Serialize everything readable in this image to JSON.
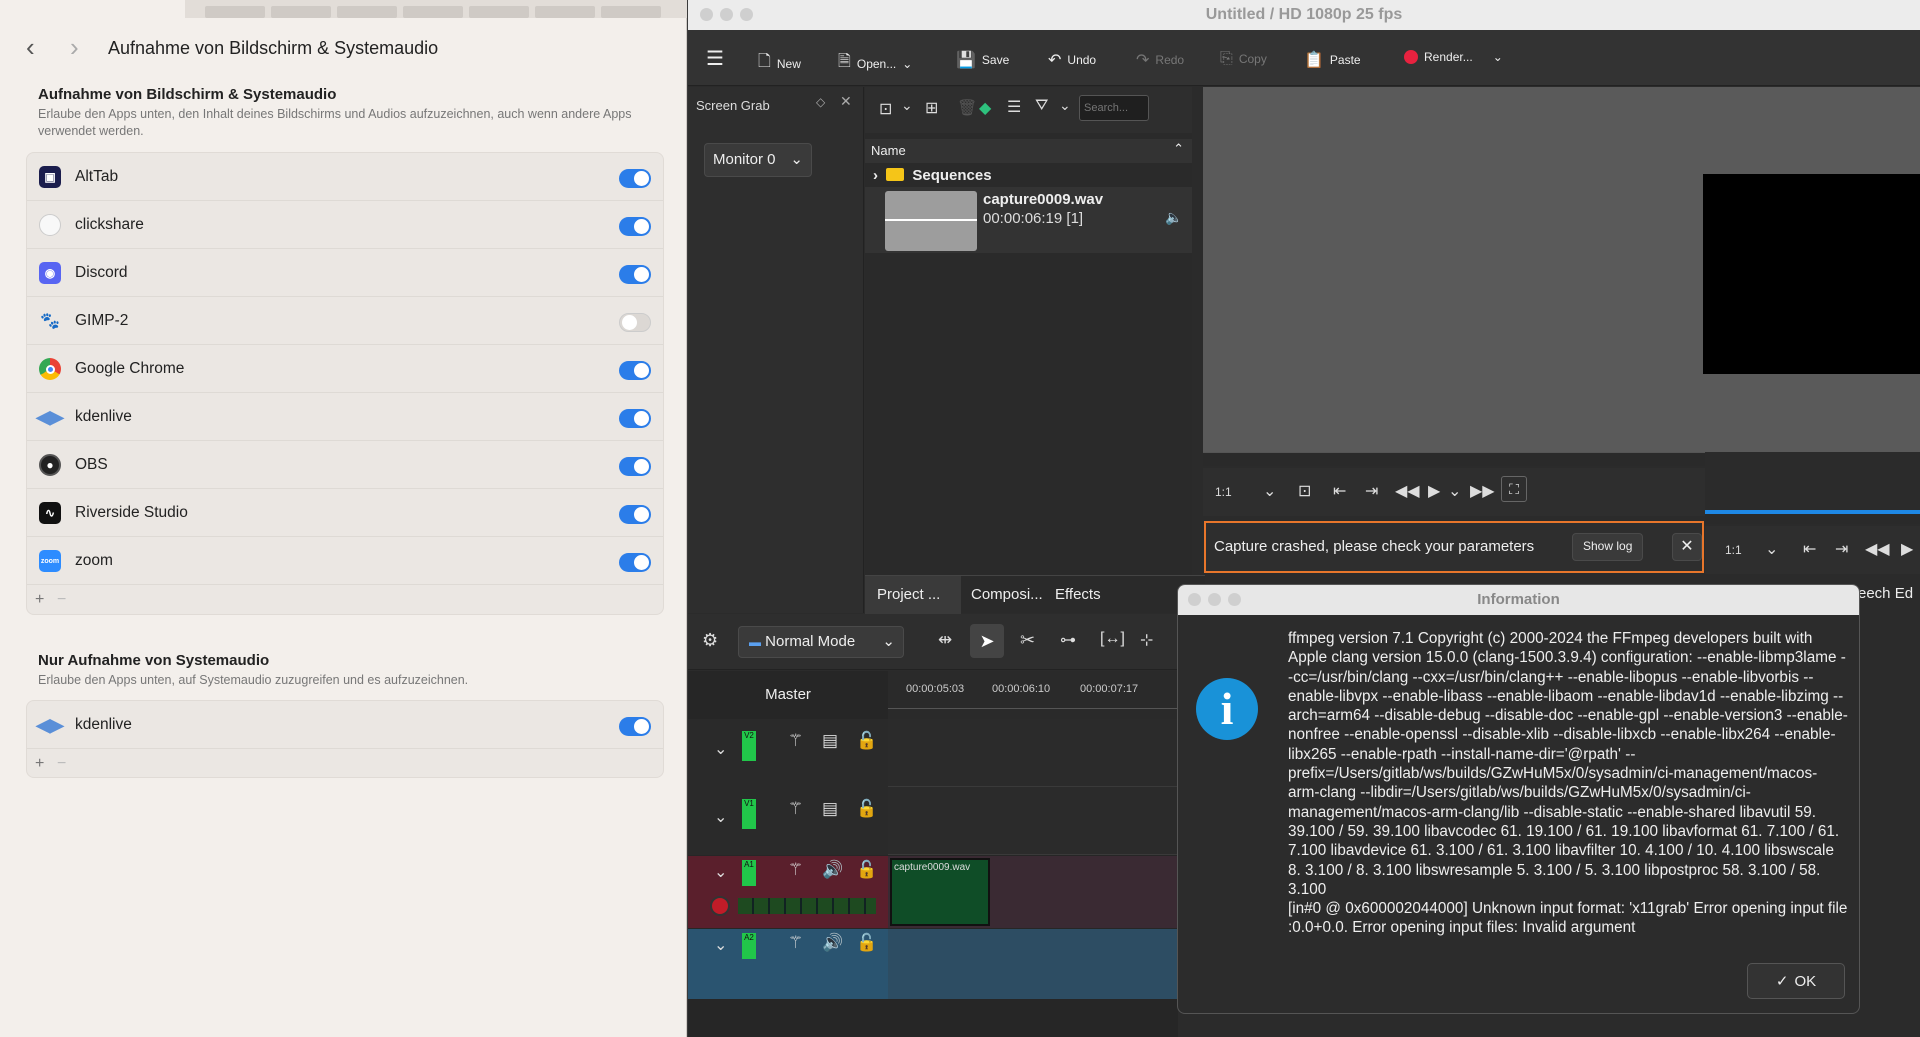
{
  "settings": {
    "header_title": "Aufnahme von Bildschirm & Systemaudio",
    "screen_section": {
      "title": "Aufnahme von Bildschirm & Systemaudio",
      "description": "Erlaube den Apps unten, den Inhalt deines Bildschirms und Audios aufzuzeichnen, auch wenn andere Apps verwendet werden.",
      "apps": [
        {
          "name": "AltTab",
          "enabled": true
        },
        {
          "name": "clickshare",
          "enabled": true
        },
        {
          "name": "Discord",
          "enabled": true
        },
        {
          "name": "GIMP-2",
          "enabled": false
        },
        {
          "name": "Google Chrome",
          "enabled": true
        },
        {
          "name": "kdenlive",
          "enabled": true
        },
        {
          "name": "OBS",
          "enabled": true
        },
        {
          "name": "Riverside Studio",
          "enabled": true
        },
        {
          "name": "zoom",
          "enabled": true
        }
      ]
    },
    "audio_section": {
      "title": "Nur Aufnahme von Systemaudio",
      "description": "Erlaube den Apps unten, auf Systemaudio zuzugreifen und es aufzuzeichnen.",
      "apps": [
        {
          "name": "kdenlive",
          "enabled": true
        }
      ]
    },
    "plus": "+",
    "minus": "−"
  },
  "kdenlive": {
    "window_title": "Untitled / HD 1080p 25 fps",
    "toolbar": {
      "new": "New",
      "open": "Open...",
      "save": "Save",
      "undo": "Undo",
      "redo": "Redo",
      "copy": "Copy",
      "paste": "Paste",
      "render": "Render..."
    },
    "screen_grab": {
      "title": "Screen Grab",
      "monitor": "Monitor 0"
    },
    "bin": {
      "search_placeholder": "Search...",
      "column_name": "Name",
      "folder": "Sequences",
      "clip_name": "capture0009.wav",
      "clip_duration": "00:00:06:19 [1]"
    },
    "monitor": {
      "zoom": "1:1",
      "zoom2": "1:1"
    },
    "error_banner": {
      "text": "Capture crashed, please check your parameters",
      "show_log": "Show log"
    },
    "dock_tabs": [
      "Project ...",
      "Composi...",
      "Effects"
    ],
    "right_tab_partial": "eech Ed",
    "timeline": {
      "mode": "Normal Mode",
      "master": "Master",
      "ruler": [
        "00:00:05:03",
        "00:00:06:10",
        "00:00:07:17"
      ],
      "tracks": [
        "V2",
        "V1",
        "A1",
        "A2"
      ],
      "clip_label": "capture0009.wav"
    },
    "dialog": {
      "title": "Information",
      "message": "ffmpeg version 7.1 Copyright (c) 2000-2024 the FFmpeg developers built with Apple clang version 15.0.0 (clang-1500.3.9.4) configuration: --enable-libmp3lame --cc=/usr/bin/clang --cxx=/usr/bin/clang++ --enable-libopus --enable-libvorbis --enable-libvpx --enable-libass --enable-libaom --enable-libdav1d --enable-libzimg --arch=arm64 --disable-debug --disable-doc --enable-gpl --enable-version3 --enable-nonfree --enable-openssl --disable-xlib --disable-libxcb --enable-libx264 --enable-libx265 --enable-rpath --install-name-dir='@rpath' --prefix=/Users/gitlab/ws/builds/GZwHuM5x/0/sysadmin/ci-management/macos-arm-clang --libdir=/Users/gitlab/ws/builds/GZwHuM5x/0/sysadmin/ci-management/macos-arm-clang/lib --disable-static --enable-shared libavutil 59. 39.100 / 59. 39.100 libavcodec 61. 19.100 / 61. 19.100 libavformat 61. 7.100 / 61. 7.100 libavdevice 61. 3.100 / 61. 3.100 libavfilter 10. 4.100 / 10. 4.100 libswscale 8. 3.100 / 8. 3.100 libswresample 5. 3.100 / 5. 3.100 libpostproc 58. 3.100 / 58. 3.100\n[in#0 @ 0x600002044000] Unknown input format: 'x11grab' Error opening input file :0.0+0.0. Error opening input files: Invalid argument",
      "ok": "OK"
    },
    "colors": {
      "accent": "#2b7de9",
      "error_border": "#e8762b",
      "record": "#e8223f",
      "info": "#1992d8"
    }
  }
}
